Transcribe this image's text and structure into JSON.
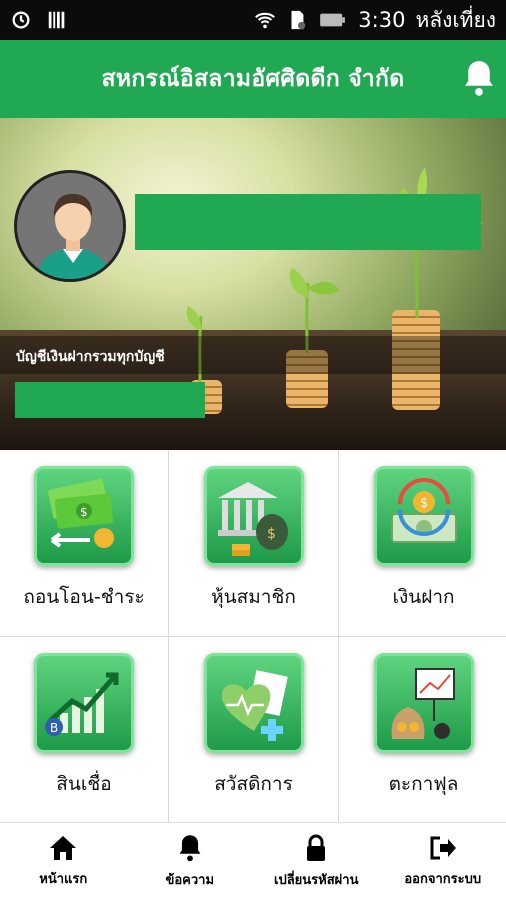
{
  "status_bar": {
    "time": "3:30",
    "period": "หลังเที่ยง"
  },
  "header": {
    "title": "สหกรณ์อิสลามอัศศิดดีก จำกัด",
    "notification_icon": "bell-icon"
  },
  "profile": {
    "avatar_icon": "user-avatar-icon",
    "account_label": "บัญชีเงินฝากรวมทุกบัญชี"
  },
  "menu": [
    {
      "label": "ถอนโอน-ชำระ",
      "icon": "money-transfer-icon"
    },
    {
      "label": "หุ้นสมาชิก",
      "icon": "bank-shares-icon"
    },
    {
      "label": "เงินฝาก",
      "icon": "deposit-icon"
    },
    {
      "label": "สินเชื่อ",
      "icon": "loan-chart-icon"
    },
    {
      "label": "สวัสดิการ",
      "icon": "welfare-icon"
    },
    {
      "label": "ตะกาฟุล",
      "icon": "takaful-icon"
    }
  ],
  "bottom_nav": [
    {
      "label": "หน้าแรก",
      "icon": "home-icon"
    },
    {
      "label": "ข้อความ",
      "icon": "bell-icon"
    },
    {
      "label": "เปลี่ยนรหัสผ่าน",
      "icon": "lock-icon"
    },
    {
      "label": "ออกจากระบบ",
      "icon": "logout-icon"
    }
  ],
  "colors": {
    "primary": "#21a853",
    "status_bar": "#0b0b0b"
  }
}
